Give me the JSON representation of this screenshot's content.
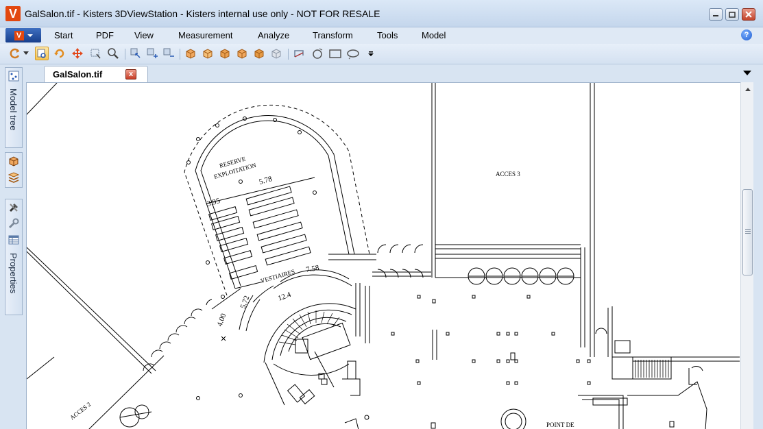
{
  "window": {
    "title": "GalSalon.tif - Kisters 3DViewStation - Kisters internal use only - NOT FOR RESALE",
    "logo_letter": "V"
  },
  "menu": {
    "app_button_letter": "V",
    "items": [
      "Start",
      "PDF",
      "View",
      "Measurement",
      "Analyze",
      "Transform",
      "Tools",
      "Model"
    ],
    "help_glyph": "?"
  },
  "toolbar": {
    "icons": [
      "refresh-icon",
      "select-icon",
      "rotate-icon",
      "pan-icon",
      "zoom-window-icon",
      "zoom-icon",
      "select-box-icon",
      "select-add-icon",
      "select-remove-icon",
      "view-front-icon",
      "view-back-icon",
      "view-left-icon",
      "view-right-icon",
      "view-top-icon",
      "view-bottom-icon",
      "markup-line-icon",
      "markup-circle-icon",
      "markup-rect-icon",
      "markup-cloud-icon",
      "overflow-icon"
    ],
    "active_icon": "select-icon"
  },
  "side_panel": {
    "model_tree_label": "Model tree",
    "properties_label": "Properties"
  },
  "document": {
    "tab_label": "GalSalon.tif",
    "close_glyph": "x"
  },
  "drawing": {
    "labels": {
      "reserve": "RESERVE",
      "exploitation": "EXPLOITATION",
      "vestiaires": "VESTIAIRES",
      "acces3": "ACCES 3",
      "acces2": "ACCES 2",
      "point_de": "POINT DE"
    },
    "dimensions": [
      "3.95",
      "5.78",
      "7.58",
      "12.4",
      "5.72",
      "4.00"
    ]
  },
  "colors": {
    "accent": "#e2470f",
    "chrome": "#d8e4f2",
    "menu_button": "#1f4c9c"
  }
}
